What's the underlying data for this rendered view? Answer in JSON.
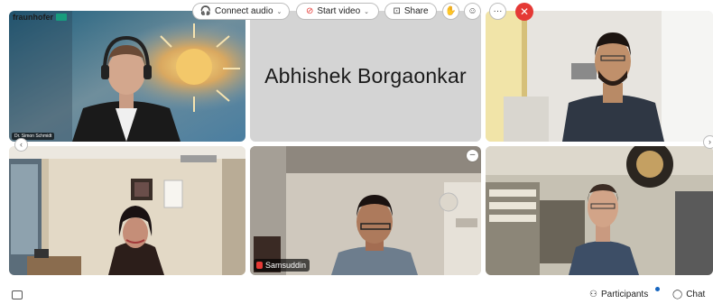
{
  "tiles": {
    "tile1": {
      "brand": "fraunhofer",
      "name_tag": "Dr. Simon Schmidt"
    },
    "tile2": {
      "name": "Abhishek Borgaonkar"
    },
    "tile5": {
      "name_tag": "Samsuddin"
    }
  },
  "toolbar": {
    "connect_audio": "Connect audio",
    "start_video": "Start video",
    "share": "Share",
    "participants": "Participants",
    "chat": "Chat"
  },
  "icons": {
    "caption": "caption-icon",
    "headphone": "headphone-icon",
    "camera_off": "camera-off-icon",
    "share": "share-icon",
    "raise_hand": "raise-hand-icon",
    "reaction": "reaction-icon",
    "more": "more-icon",
    "end_call": "end-call-icon",
    "participants": "participants-icon",
    "chat": "chat-icon"
  },
  "colors": {
    "end_call": "#e53935",
    "participants_badge": "#1565c0",
    "camera_off": "#e53935",
    "fraunhofer": "#179c7d"
  }
}
